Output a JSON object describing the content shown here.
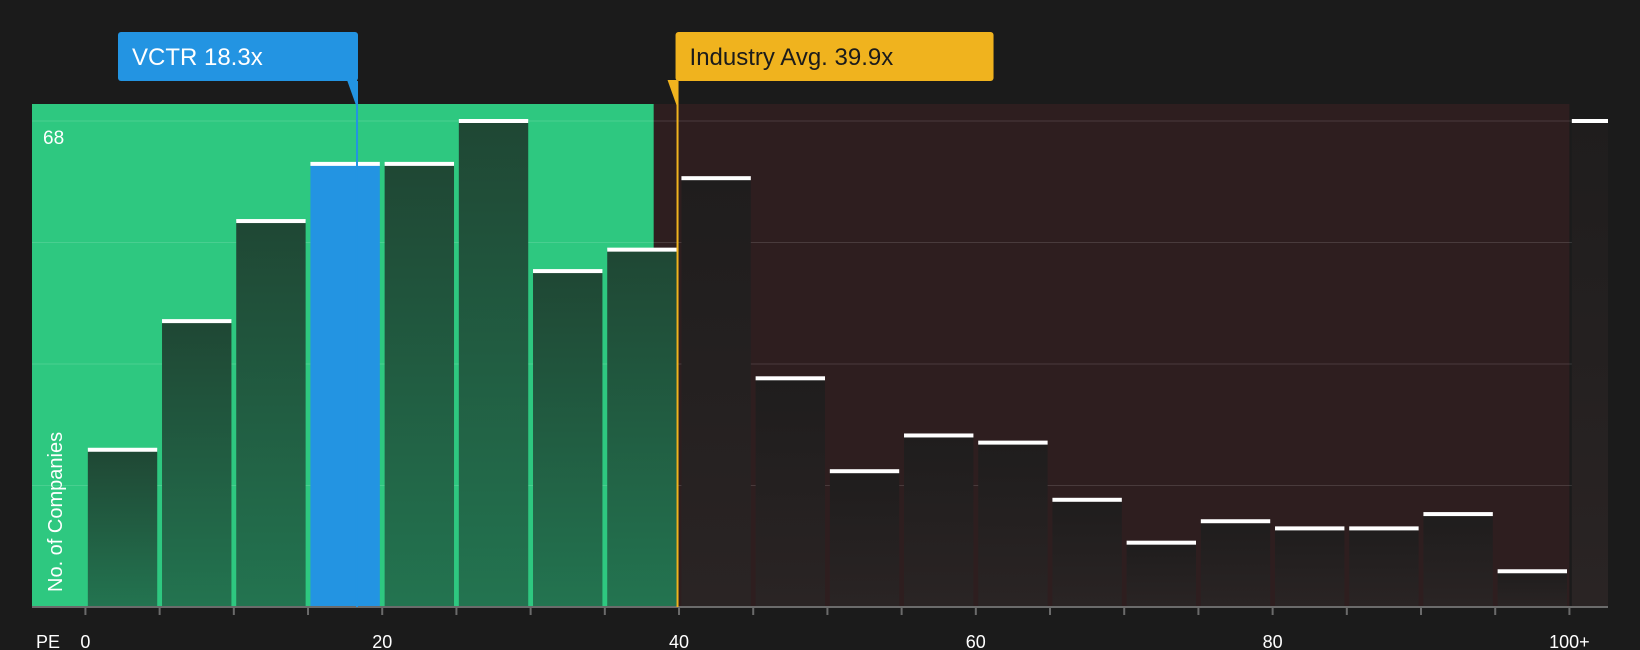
{
  "chart_data": {
    "type": "bar",
    "xlabel": "PE",
    "ylabel": "No. of Companies",
    "ymax_label": "68",
    "ylim": [
      0,
      68
    ],
    "xlim": [
      -3.6,
      102.6
    ],
    "bin_width": 5,
    "x_ticks": [
      {
        "value": 0,
        "label": "0"
      },
      {
        "value": 20,
        "label": "20"
      },
      {
        "value": 40,
        "label": "40"
      },
      {
        "value": 60,
        "label": "60"
      },
      {
        "value": 80,
        "label": "80"
      },
      {
        "value": 100,
        "label": "100+"
      }
    ],
    "bins": [
      {
        "start": 0,
        "end": 5,
        "value": 22
      },
      {
        "start": 5,
        "end": 10,
        "value": 40
      },
      {
        "start": 10,
        "end": 15,
        "value": 54
      },
      {
        "start": 15,
        "end": 20,
        "value": 62,
        "highlight": true
      },
      {
        "start": 20,
        "end": 25,
        "value": 62
      },
      {
        "start": 25,
        "end": 30,
        "value": 68
      },
      {
        "start": 30,
        "end": 35,
        "value": 47
      },
      {
        "start": 35,
        "end": 40,
        "value": 50
      },
      {
        "start": 40,
        "end": 45,
        "value": 60
      },
      {
        "start": 45,
        "end": 50,
        "value": 32
      },
      {
        "start": 50,
        "end": 55,
        "value": 19
      },
      {
        "start": 55,
        "end": 60,
        "value": 24
      },
      {
        "start": 60,
        "end": 65,
        "value": 23
      },
      {
        "start": 65,
        "end": 70,
        "value": 15
      },
      {
        "start": 70,
        "end": 75,
        "value": 9
      },
      {
        "start": 75,
        "end": 80,
        "value": 12
      },
      {
        "start": 80,
        "end": 85,
        "value": 11
      },
      {
        "start": 85,
        "end": 90,
        "value": 11
      },
      {
        "start": 90,
        "end": 95,
        "value": 13
      },
      {
        "start": 95,
        "end": 100,
        "value": 5
      },
      {
        "start": 100,
        "end": 105,
        "value": 68
      }
    ],
    "subject": {
      "label": "VCTR 18.3x",
      "value": 18.3
    },
    "industry": {
      "label": "Industry Avg. 39.9x",
      "value": 39.9
    },
    "fair_zone_end": 38.3,
    "colors": {
      "background": "#1b1b1b",
      "fair_zone": "#2ec880",
      "over_zone": "#2e1e1f",
      "bar_fair": "#1f5a3e",
      "bar_over": "#252222",
      "highlight": "#2394e2",
      "industry": "#f0b31e",
      "cap": "#ffffff",
      "text": "#ffffff"
    }
  }
}
